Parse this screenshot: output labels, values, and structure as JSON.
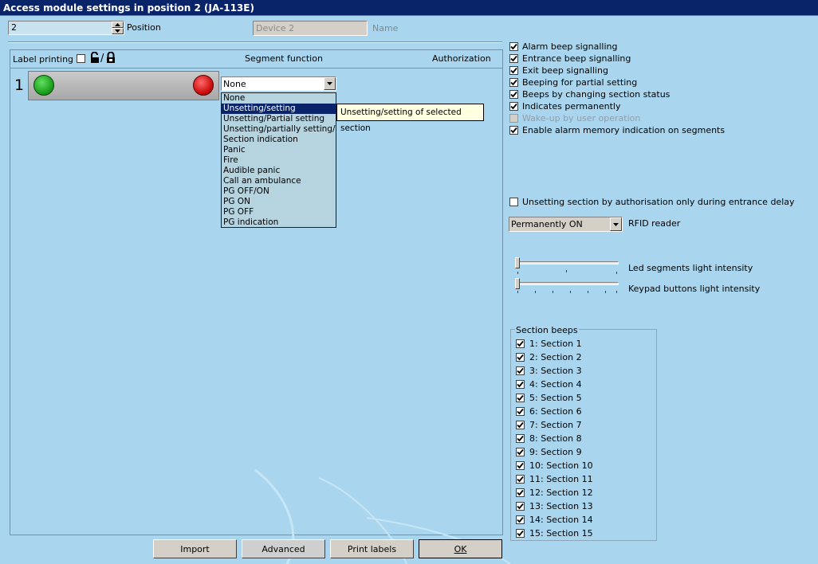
{
  "window": {
    "title": "Access module settings in position 2 (JA-113E)"
  },
  "header": {
    "position_value": "2",
    "position_label": "Position",
    "name_value": "Device 2",
    "name_label": "Name"
  },
  "table": {
    "label_printing": "Label printing",
    "lock_separator": "/",
    "segment_function": "Segment function",
    "authorization": "Authorization",
    "row_number": "1",
    "selected_function": "None"
  },
  "dropdown": {
    "items": [
      "None",
      "Unsetting/setting",
      "Unsetting/Partial setting",
      "Unsetting/partially setting/setting",
      "Section indication",
      "Panic",
      "Fire",
      "Audible panic",
      "Call an ambulance",
      "PG OFF/ON",
      "PG ON",
      "PG OFF",
      "PG indication"
    ],
    "highlighted_index": 1,
    "tooltip": "Unsetting/setting of selected section"
  },
  "options": [
    {
      "label": "Alarm beep signalling",
      "checked": true,
      "enabled": true
    },
    {
      "label": "Entrance beep signalling",
      "checked": true,
      "enabled": true
    },
    {
      "label": "Exit beep signalling",
      "checked": true,
      "enabled": true
    },
    {
      "label": "Beeping for partial setting",
      "checked": true,
      "enabled": true
    },
    {
      "label": "Beeps by changing section status",
      "checked": true,
      "enabled": true
    },
    {
      "label": "Indicates permanently",
      "checked": true,
      "enabled": true
    },
    {
      "label": "Wake-up by user operation",
      "checked": false,
      "enabled": false
    },
    {
      "label": "Enable alarm memory indication on segments",
      "checked": true,
      "enabled": true
    }
  ],
  "unsetting_option": {
    "label": "Unsetting section by authorisation only during entrance delay",
    "checked": false
  },
  "rfid": {
    "value": "Permanently ON",
    "label": "RFID reader"
  },
  "sliders": [
    {
      "label": "Led segments light intensity",
      "level": 0
    },
    {
      "label": "Keypad buttons light intensity",
      "level": 0
    }
  ],
  "section_beeps": {
    "title": "Section beeps",
    "items": [
      "1: Section 1",
      "2: Section 2",
      "3: Section 3",
      "4: Section 4",
      "5: Section 5",
      "6: Section 6",
      "7: Section 7",
      "8: Section 8",
      "9: Section 9",
      "10: Section 10",
      "11: Section 11",
      "12: Section 12",
      "13: Section 13",
      "14: Section 14",
      "15: Section 15"
    ]
  },
  "buttons": {
    "import": "Import",
    "advanced": "Advanced",
    "print_labels": "Print labels",
    "ok": "OK"
  },
  "colors": {
    "background": "#a9d6ee",
    "title_bar": "#0a246a",
    "led_green": "#1fa31f",
    "led_red": "#d01010",
    "tooltip_bg": "#ffffe1"
  }
}
